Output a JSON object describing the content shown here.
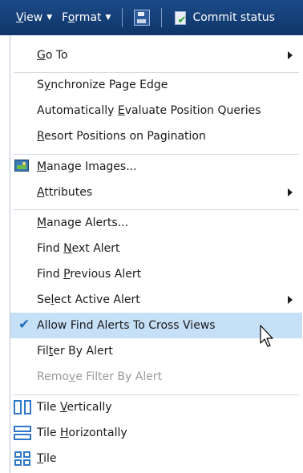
{
  "toolbar": {
    "view": {
      "pre": "",
      "mn": "V",
      "post": "iew"
    },
    "format": {
      "pre": "F",
      "mn": "o",
      "post": "rmat"
    },
    "commit": "Commit status"
  },
  "menu": {
    "go_to": {
      "pre": "",
      "mn": "G",
      "post": "o To"
    },
    "sync": {
      "pre": "S",
      "mn": "y",
      "post": "nchronize Page Edge"
    },
    "auto_eval": {
      "pre": "Automatically ",
      "mn": "E",
      "post": "valuate Position Queries"
    },
    "resort": {
      "pre": "",
      "mn": "R",
      "post": "esort Positions on Pagination"
    },
    "manage_images": {
      "pre": "",
      "mn": "M",
      "post": "anage Images..."
    },
    "attributes": {
      "pre": "",
      "mn": "A",
      "post": "ttributes"
    },
    "manage_alerts": {
      "pre": "",
      "mn": "M",
      "post": "anage Alerts..."
    },
    "find_next": {
      "pre": "Find ",
      "mn": "N",
      "post": "ext Alert"
    },
    "find_prev": {
      "pre": "Find ",
      "mn": "P",
      "post": "revious Alert"
    },
    "select_active": {
      "pre": "Se",
      "mn": "l",
      "post": "ect Active Alert"
    },
    "allow_cross": {
      "pre": "Allow Find Alerts To Cross Views",
      "mn": "",
      "post": ""
    },
    "filter_by": {
      "pre": "Fil",
      "mn": "t",
      "post": "er By Alert"
    },
    "remove_filter": {
      "pre": "Remo",
      "mn": "v",
      "post": "e Filter By Alert"
    },
    "tile_v": {
      "pre": "Tile ",
      "mn": "V",
      "post": "ertically"
    },
    "tile_h": {
      "pre": "Tile ",
      "mn": "H",
      "post": "orizontally"
    },
    "tile": {
      "pre": "",
      "mn": "T",
      "post": "ile"
    }
  },
  "icons": {
    "submenu": "chevron-right-icon",
    "checked": "checkmark-icon",
    "images": "image-icon",
    "tile_vertical": "tile-vertical-icon",
    "tile_horizontal": "tile-horizontal-icon",
    "tile_grid": "tile-grid-icon"
  },
  "colors": {
    "toolbar_bg": "#1c4a88",
    "highlight": "#c6e0f8",
    "check": "#1f6fbf",
    "tile_icon": "#2f77c8"
  }
}
